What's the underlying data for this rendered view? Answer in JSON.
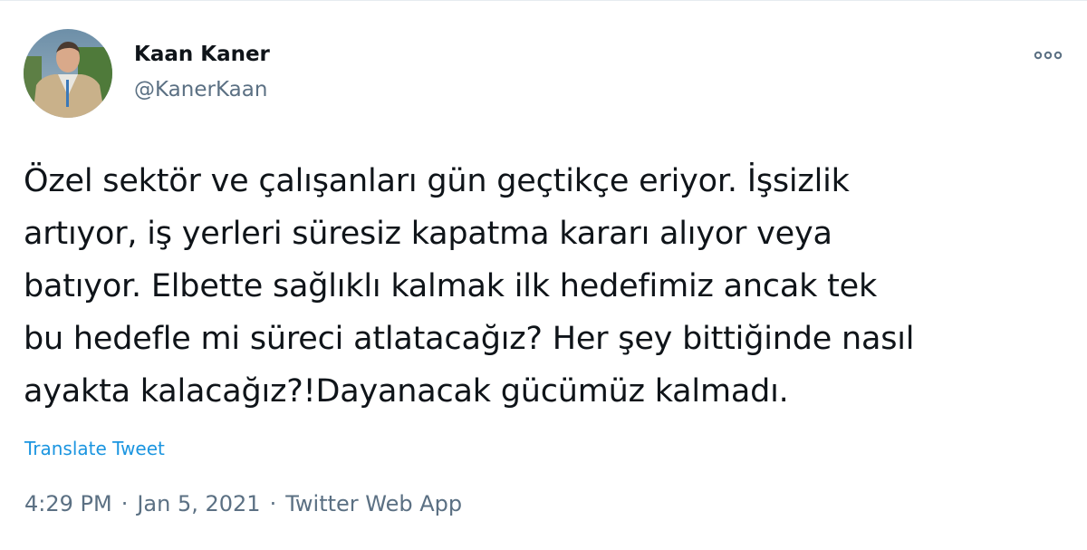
{
  "user": {
    "name": "Kaan Kaner",
    "handle": "@KanerKaan"
  },
  "tweet": {
    "text": "Özel sektör ve çalışanları gün geçtikçe eriyor. İşsizlik\nartıyor, iş yerleri süresiz kapatma kararı alıyor veya\nbatıyor. Elbette sağlıklı kalmak ilk hedefimiz ancak tek\nbu hedefle mi süreci atlatacağız? Her şey bittiğinde nasıl\nayakta kalacağız?!Dayanacak gücümüz kalmadı.",
    "translate_label": "Translate Tweet"
  },
  "meta": {
    "time": "4:29 PM",
    "separator": "·",
    "date": "Jan 5, 2021",
    "source": "Twitter Web App"
  },
  "icons": {
    "more": "more-horizontal-icon"
  },
  "colors": {
    "link": "#1b95e0",
    "secondary_text": "#5b7083",
    "primary_text": "#0f1419"
  }
}
